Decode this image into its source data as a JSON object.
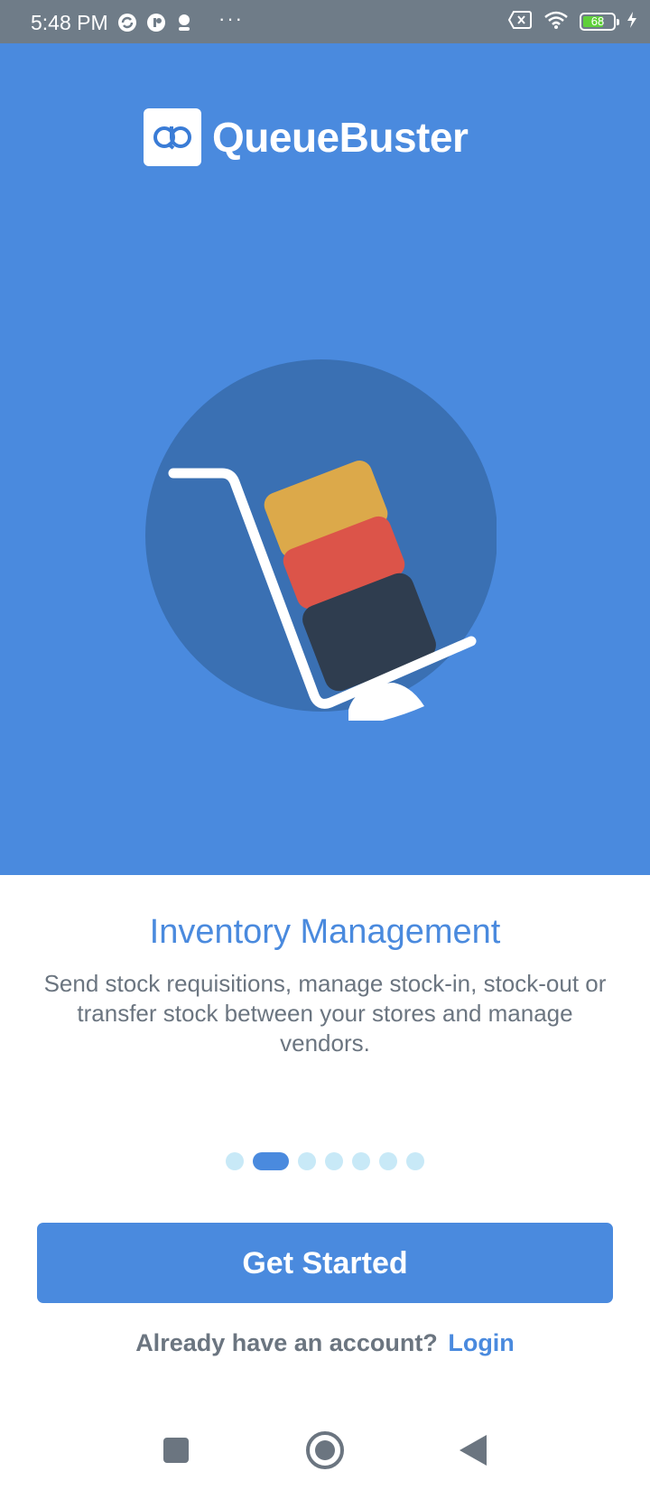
{
  "status_bar": {
    "time": "5:48 PM",
    "more": "···",
    "battery_level": "68",
    "battery_fraction": 0.68,
    "icons": [
      "sync-icon",
      "app-icon",
      "notification-icon",
      "sim-no-signal-icon",
      "wifi-icon",
      "battery-icon",
      "charging-icon"
    ]
  },
  "app": {
    "logo_mark": "QB",
    "logo_text": "QueueBuster"
  },
  "illustration": {
    "name": "hand-truck-with-boxes",
    "colors": {
      "background": "#4a8ade",
      "circle": "#3a70b3",
      "box_top": "#dca94a",
      "box_middle": "#dc5449",
      "box_bottom": "#2f3d4f",
      "cart": "#ffffff"
    }
  },
  "onboarding": {
    "title": "Inventory Management",
    "description": "Send stock requisitions, manage stock-in, stock-out or transfer stock between your stores and manage vendors.",
    "page_count": 7,
    "active_page": 2
  },
  "actions": {
    "get_started": "Get Started",
    "login_prompt": "Already have an account?",
    "login_link": "Login"
  },
  "nav_bar": {
    "recents": "recents-square-icon",
    "home": "home-circle-icon",
    "back": "back-triangle-icon"
  },
  "colors": {
    "accent": "#4a8ade",
    "text_secondary": "#6b7580",
    "dot_inactive": "#c8e9f7"
  }
}
